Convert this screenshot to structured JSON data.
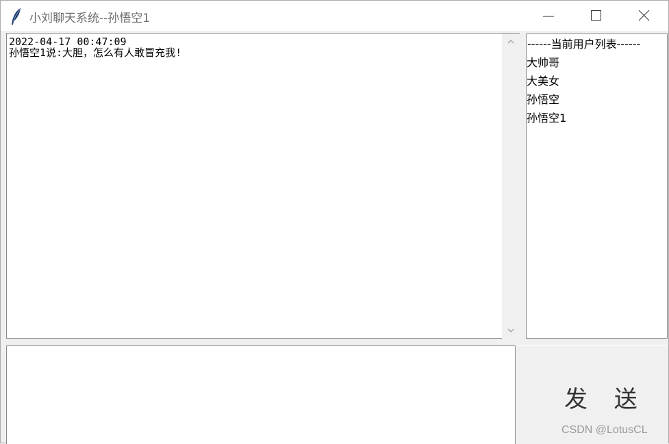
{
  "window": {
    "title": "小刘聊天系统--孙悟空1",
    "icon": "feather-icon",
    "controls": [
      "minimize-icon",
      "maximize-icon",
      "close-icon"
    ]
  },
  "chat": {
    "messages": [
      {
        "timestamp": "2022-04-17 00:47:09",
        "text": "孙悟空1说:大胆，怎么有人敢冒充我!"
      }
    ]
  },
  "user_list": {
    "header": "------当前用户列表------",
    "users": [
      "大帅哥",
      "大美女",
      "孙悟空",
      "孙悟空1"
    ]
  },
  "input": {
    "value": ""
  },
  "send_button": {
    "label": "发 送"
  },
  "watermark": "CSDN @LotusCL"
}
